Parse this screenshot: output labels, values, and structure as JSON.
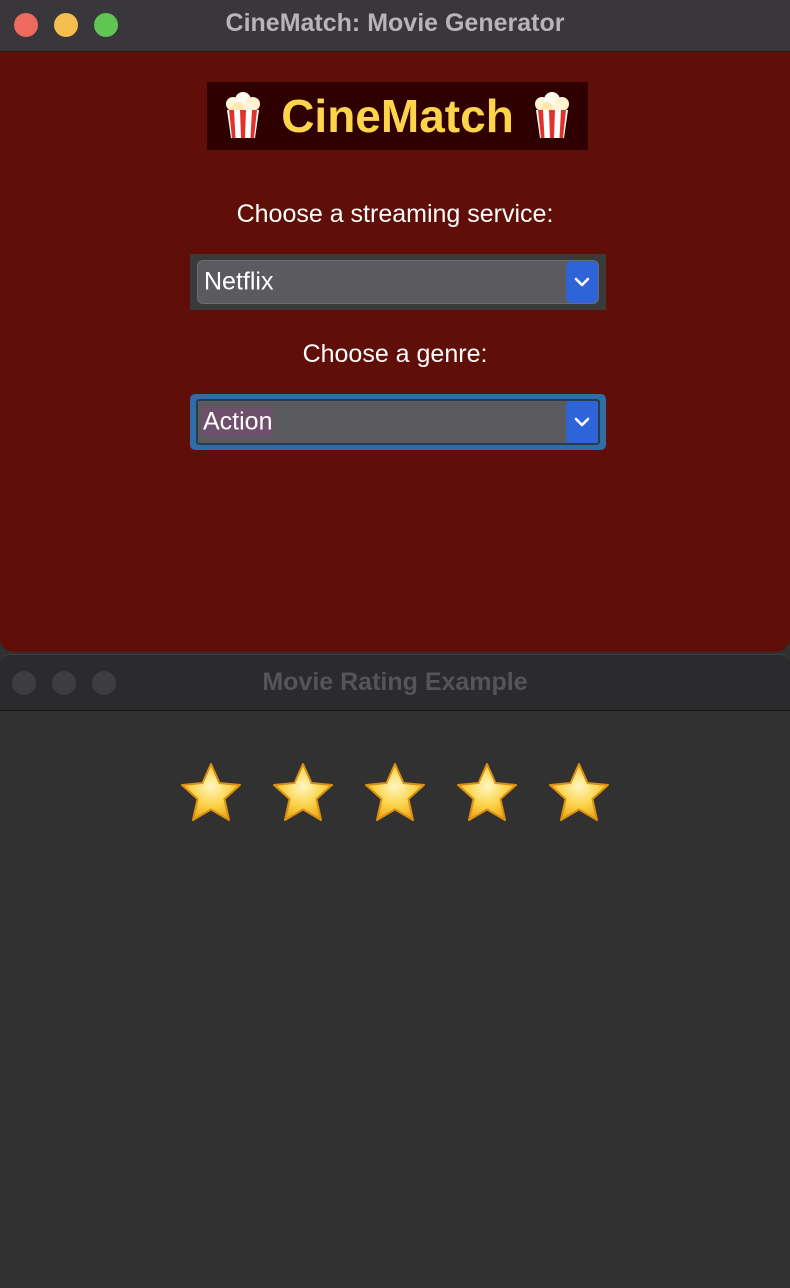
{
  "window_main": {
    "title": "CineMatch: Movie Generator",
    "banner_text": "CineMatch",
    "banner_icon": "popcorn-icon",
    "service_label": "Choose a streaming service:",
    "service_value": "Netflix",
    "genre_label": "Choose a genre:",
    "genre_value": "Action",
    "colors": {
      "background": "#5f0e08",
      "banner_bg": "#2e0000",
      "banner_text": "#fdd44a",
      "select_accent": "#2f64d9",
      "focus_ring": "#2e6ea8"
    }
  },
  "window_rating": {
    "title": "Movie Rating Example",
    "star_icon": "star-icon",
    "stars_total": 5,
    "stars_filled": 5
  }
}
